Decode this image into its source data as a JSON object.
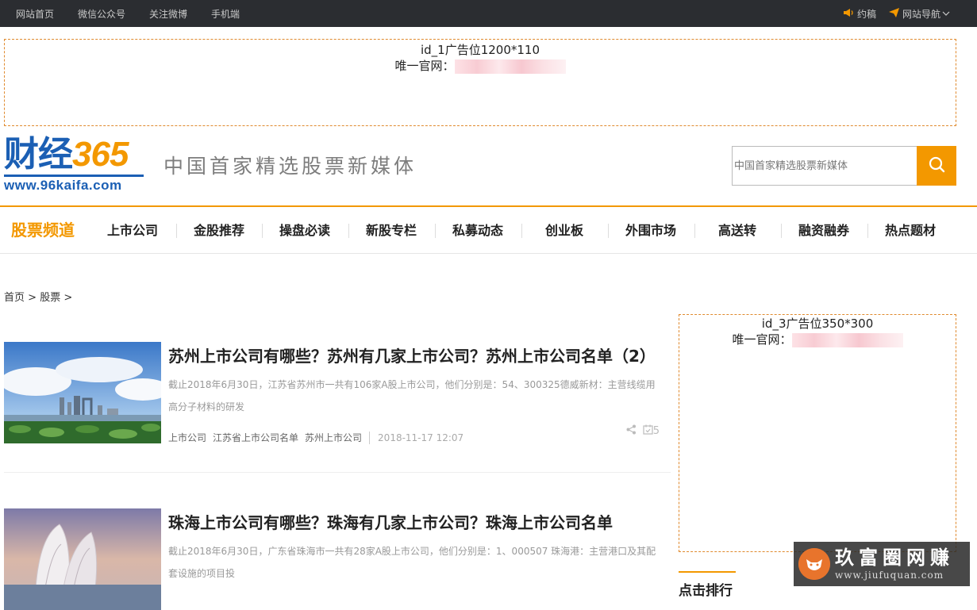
{
  "topbar": {
    "left_links": [
      "网站首页",
      "微信公众号",
      "关注微博",
      "手机端"
    ],
    "contribute": "约稿",
    "site_nav": "网站导航",
    "accent": "#f39800"
  },
  "ad_top": {
    "label": "id_1广告位1200*110",
    "owner_prefix": "唯一官网："
  },
  "logo": {
    "brand_cn": "财经",
    "brand_num": "365",
    "url": "www.96kaifa.com"
  },
  "slogan": "中国首家精选股票新媒体",
  "search": {
    "placeholder": "中国首家精选股票新媒体",
    "icon": "search-icon"
  },
  "nav": {
    "channel": "股票频道",
    "items": [
      "上市公司",
      "金股推荐",
      "操盘必读",
      "新股专栏",
      "私募动态",
      "创业板",
      "外围市场",
      "高送转",
      "融资融券",
      "热点题材"
    ]
  },
  "breadcrumb": {
    "home": "首页",
    "sep": ">",
    "section": "股票"
  },
  "articles": [
    {
      "title": "苏州上市公司有哪些？苏州有几家上市公司？苏州上市公司名单（2）",
      "desc": "截止2018年6月30日，江苏省苏州市一共有106家A股上市公司，他们分别是：54、300325德威新材：主营线缆用高分子材料的研发",
      "tags": [
        "上市公司",
        "江苏省上市公司名单",
        "苏州上市公司"
      ],
      "date": "2018-11-17 12:07",
      "count": "5"
    },
    {
      "title": "珠海上市公司有哪些？珠海有几家上市公司？珠海上市公司名单",
      "desc": "截止2018年6月30日，广东省珠海市一共有28家A股上市公司，他们分别是：1、000507 珠海港：主营港口及其配套设施的项目投",
      "tags": [],
      "date": "",
      "count": ""
    }
  ],
  "ad_side": {
    "label": "id_3广告位350*300",
    "owner_prefix": "唯一官网："
  },
  "rank": {
    "title": "点击排行"
  },
  "watermark": {
    "name": "玖富圈网赚",
    "url": "www.jiufuquan.com"
  }
}
